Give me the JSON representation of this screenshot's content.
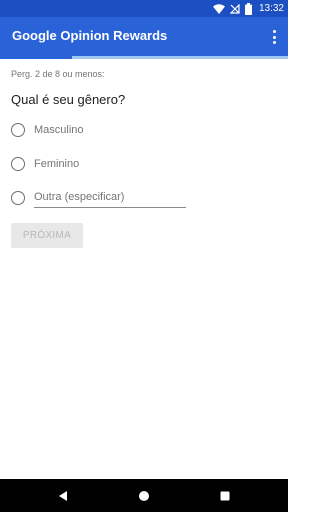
{
  "status_bar": {
    "time": "13:32",
    "icons": [
      "wifi-icon",
      "no-signal-icon",
      "battery-icon"
    ],
    "color": "#1c4fc2"
  },
  "app_bar": {
    "title": "Google Opinion Rewards",
    "overflow_icon": "more-vert-icon",
    "color": "#2a63d8"
  },
  "progress": {
    "fraction": 0.25,
    "track_color": "#9ec7ee",
    "fill_color": "#2a63d8"
  },
  "survey": {
    "counter": "Perg. 2 de 8 ou menos:",
    "question": "Qual é seu gênero?",
    "options": [
      {
        "label": "Masculino"
      },
      {
        "label": "Feminino"
      }
    ],
    "other_placeholder": "Outra (especificar)",
    "next_label": "PRÓXIMA"
  },
  "nav_bar": {
    "icons": [
      "back-icon",
      "home-icon",
      "recents-icon"
    ]
  }
}
